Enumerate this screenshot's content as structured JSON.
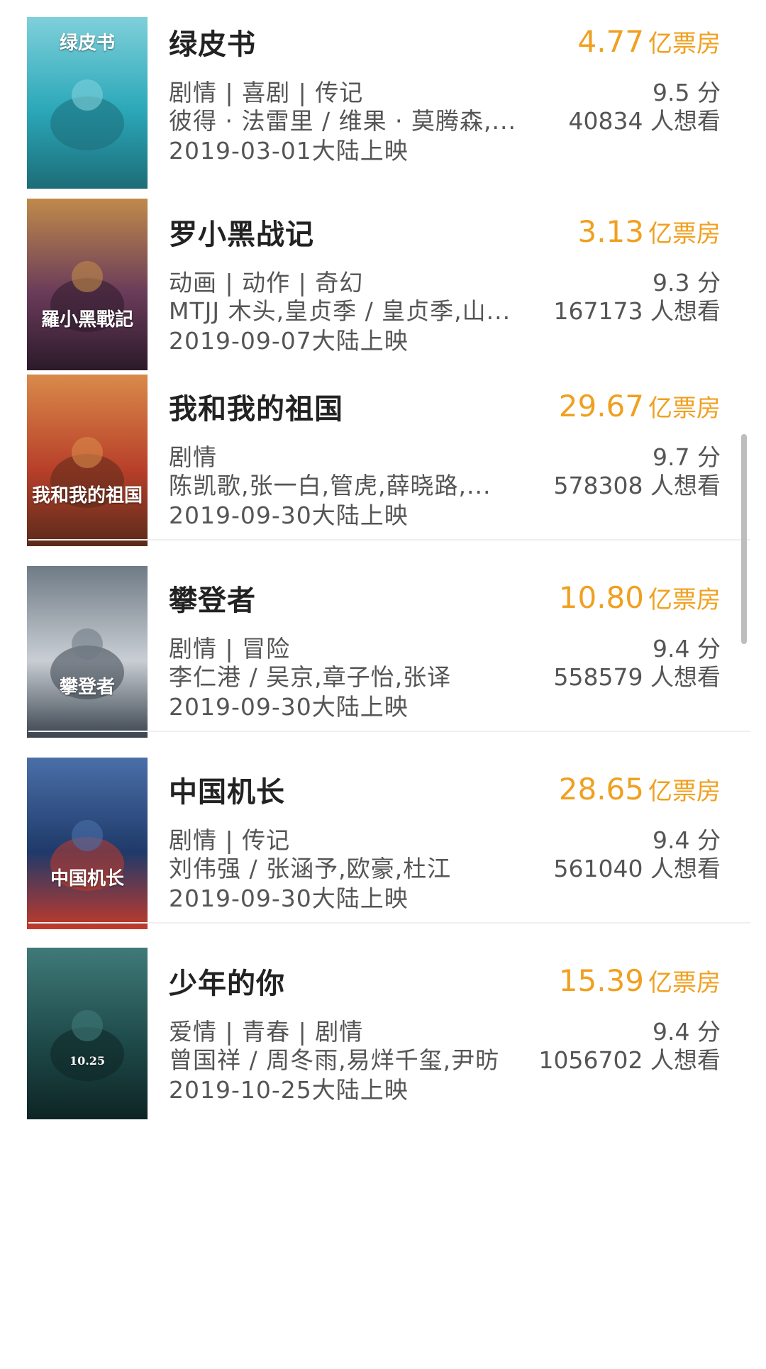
{
  "movies": [
    {
      "title": "绿皮书",
      "box_value": "4.77",
      "box_unit": "亿票房",
      "genres": "剧情 | 喜剧 | 传记",
      "cast": "彼得 · 法雷里 / 维果 · 莫腾森,...",
      "release": "2019-03-01大陆上映",
      "rating": "9.5 分",
      "want": "40834 人想看",
      "poster": {
        "icon": "green-book-poster",
        "caption": "绿皮书",
        "colors": [
          "#2aa7b8",
          "#7fd0da",
          "#1d6c78"
        ]
      }
    },
    {
      "title": "罗小黑战记",
      "box_value": "3.13",
      "box_unit": "亿票房",
      "genres": "动画 | 动作 | 奇幻",
      "cast": "MTJJ 木头,皇贞季 / 皇贞季,山...",
      "release": "2019-09-07大陆上映",
      "rating": "9.3 分",
      "want": "167173 人想看",
      "poster": {
        "icon": "black-cat-poster",
        "caption": "羅小黑戰記",
        "colors": [
          "#6a3b5a",
          "#c08a4a",
          "#2b1a2a"
        ]
      }
    },
    {
      "title": "我和我的祖国",
      "box_value": "29.67",
      "box_unit": "亿票房",
      "genres": "剧情",
      "cast": "陈凯歌,张一白,管虎,薛晓路,...",
      "release": "2019-09-30大陆上映",
      "rating": "9.7 分",
      "want": "578308 人想看",
      "poster": {
        "icon": "faces-collage-poster",
        "caption": "我和我的祖国",
        "colors": [
          "#b8402a",
          "#d98a4a",
          "#5a2a1a"
        ]
      }
    },
    {
      "title": "攀登者",
      "box_value": "10.80",
      "box_unit": "亿票房",
      "genres": "剧情 | 冒险",
      "cast": "李仁港 / 吴京,章子怡,张译",
      "release": "2019-09-30大陆上映",
      "rating": "9.4 分",
      "want": "558579 人想看",
      "poster": {
        "icon": "mountain-climber-poster",
        "caption": "攀登者",
        "colors": [
          "#c9ced4",
          "#6f7b86",
          "#3a444e"
        ]
      }
    },
    {
      "title": "中国机长",
      "box_value": "28.65",
      "box_unit": "亿票房",
      "genres": "剧情 | 传记",
      "cast": "刘伟强 / 张涵予,欧豪,杜江",
      "release": "2019-09-30大陆上映",
      "rating": "9.4 分",
      "want": "561040 人想看",
      "poster": {
        "icon": "captain-airplane-poster",
        "caption": "中国机长",
        "colors": [
          "#1f3a6a",
          "#4a6fa8",
          "#c23a2a"
        ]
      }
    },
    {
      "title": "少年的你",
      "box_value": "15.39",
      "box_unit": "亿票房",
      "genres": "爱情 | 青春 | 剧情",
      "cast": "曾国祥 / 周冬雨,易烊千玺,尹昉",
      "release": "2019-10-25大陆上映",
      "rating": "9.4 分",
      "want": "1056702 人想看",
      "poster": {
        "icon": "rain-couple-poster",
        "caption": "10.25",
        "colors": [
          "#1e4a4a",
          "#3f7a78",
          "#0e2424"
        ]
      }
    }
  ]
}
